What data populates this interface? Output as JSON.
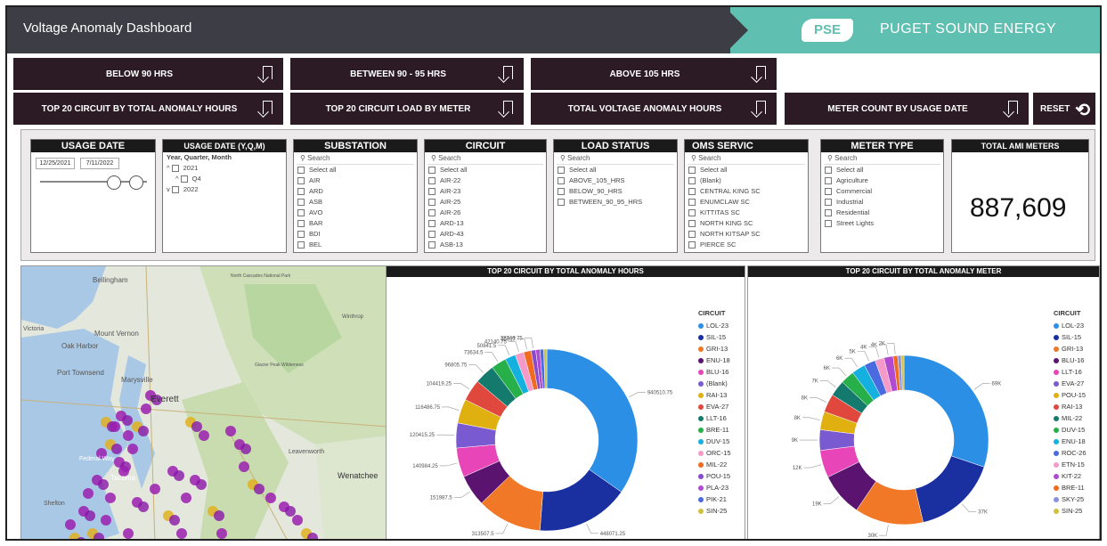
{
  "header": {
    "title": "Voltage Anomaly Dashboard",
    "logo_text": "PSE",
    "company": "PUGET SOUND ENERGY"
  },
  "buttons": {
    "below_90": "BELOW 90 HRS",
    "between_90_95": "BETWEEN 90 - 95 HRS",
    "above_105": "ABOVE 105 HRS",
    "top20_anomaly": "TOP 20 CIRCUIT BY TOTAL ANOMALY HOURS",
    "top20_load": "TOP 20 CIRCUIT LOAD BY METER",
    "total_voltage": "TOTAL VOLTAGE ANOMALY HOURS",
    "meter_count": "METER COUNT BY USAGE DATE",
    "reset": "RESET"
  },
  "slicers": {
    "usage_date": {
      "title": "USAGE DATE",
      "start": "12/25/2021",
      "end": "7/11/2022"
    },
    "usage_date_yqm": {
      "title": "USAGE DATE (Y,Q,M)",
      "subtitle": "Year, Quarter, Month",
      "items": [
        "2021",
        "Q4",
        "2022"
      ]
    },
    "substation": {
      "title": "SUBSTATION",
      "search": "Search",
      "items": [
        "Select all",
        "AIR",
        "ARD",
        "ASB",
        "AVO",
        "BAR",
        "BDI",
        "BEL"
      ]
    },
    "circuit": {
      "title": "CIRCUIT",
      "search": "Search",
      "items": [
        "Select all",
        "AIR-22",
        "AIR-23",
        "AIR-25",
        "AIR-26",
        "ARD-13",
        "ARD-43",
        "ASB-13"
      ]
    },
    "load_status": {
      "title": "LOAD STATUS",
      "search": "Search",
      "items": [
        "Select all",
        "ABOVE_105_HRS",
        "BELOW_90_HRS",
        "BETWEEN_90_95_HRS"
      ]
    },
    "oms_service": {
      "title": "OMS SERVIC",
      "search": "Search",
      "items": [
        "Select all",
        "(Blank)",
        "CENTRAL KING SC",
        "ENUMCLAW SC",
        "KITTITAS SC",
        "NORTH KING SC",
        "NORTH KITSAP SC",
        "PIERCE SC"
      ]
    },
    "meter_type": {
      "title": "METER TYPE",
      "search": "Search",
      "items": [
        "Select all",
        "Agriculture",
        "Commercial",
        "Industrial",
        "Residential",
        "Street Lights"
      ]
    },
    "total_ami": {
      "title": "TOTAL AMI METERS",
      "value": "887,609"
    }
  },
  "map": {
    "labels": [
      "Bellingham",
      "Mount Vernon",
      "Oak Harbor",
      "Port Townsend",
      "Marysville",
      "Everett",
      "Leavenworth",
      "Wenatchee",
      "Victoria",
      "Federal Way",
      "Tacoma",
      "Shelton",
      "Winthrop",
      "North Cascades National Park",
      "Glacier Peak Wilderness"
    ]
  },
  "chart_left": {
    "title": "TOP 20 CIRCUIT BY TOTAL ANOMALY HOURS",
    "legend_title": "CIRCUIT",
    "legend": [
      "LOL-23",
      "SIL-15",
      "GRI-13",
      "ENU-18",
      "BLU-16",
      "(Blank)",
      "RAI-13",
      "EVA-27",
      "LLT-16",
      "BRE-11",
      "DUV-15",
      "ORC-15",
      "MIL-22",
      "POU-15",
      "PLA-23",
      "PIK-21",
      "SIN-25"
    ],
    "labels": [
      "940510.75",
      "448071.25",
      "313507.5",
      "151987.5",
      "140984.25",
      "120415.25",
      "116486.75",
      "104419.25",
      "96805.75",
      "73634.5",
      "50841.5",
      "42140.75",
      "35817",
      "22746.75"
    ]
  },
  "chart_right": {
    "title": "TOP 20 CIRCUIT BY TOTAL ANOMALY METER",
    "legend_title": "CIRCUIT",
    "legend": [
      "LOL-23",
      "SIL-15",
      "GRI-13",
      "BLU-16",
      "LLT-16",
      "EVA-27",
      "POU-15",
      "RAI-13",
      "MIL-22",
      "DUV-15",
      "ENU-18",
      "ROC-26",
      "ETN-15",
      "KIT-22",
      "BRE-11",
      "SKY-25",
      "SIN-25"
    ],
    "labels": [
      "69K",
      "37K",
      "30K",
      "19K",
      "12K",
      "9K",
      "8K",
      "8K",
      "7K",
      "6K",
      "6K",
      "5K",
      "4K",
      "4K",
      "2K"
    ]
  },
  "chart_data": [
    {
      "type": "pie",
      "title": "TOP 20 CIRCUIT BY TOTAL ANOMALY HOURS",
      "categories": [
        "LOL-23",
        "SIL-15",
        "GRI-13",
        "ENU-18",
        "BLU-16",
        "(Blank)",
        "RAI-13",
        "EVA-27",
        "LLT-16",
        "BRE-11",
        "DUV-15",
        "ORC-15",
        "MIL-22",
        "POU-15",
        "PLA-23",
        "PIK-21",
        "SIN-25"
      ],
      "values": [
        940510.75,
        448071.25,
        313507.5,
        151987.5,
        140984.25,
        120415.25,
        116486.75,
        104419.25,
        96805.75,
        73634.5,
        50841.5,
        42140.75,
        35817,
        22746.75,
        20000,
        18000,
        15000
      ],
      "colors": [
        "#2b8fe6",
        "#1a2fa0",
        "#f07826",
        "#5a1470",
        "#e846b8",
        "#7a5ad0",
        "#e0b010",
        "#e0483e",
        "#157a6e",
        "#27b04a",
        "#13b0e0",
        "#f59ac8",
        "#f06a20",
        "#8a4ad0",
        "#b04ad0",
        "#4a6ae0",
        "#d0c040"
      ]
    },
    {
      "type": "pie",
      "title": "TOP 20 CIRCUIT BY TOTAL ANOMALY METER",
      "categories": [
        "LOL-23",
        "SIL-15",
        "GRI-13",
        "BLU-16",
        "LLT-16",
        "EVA-27",
        "POU-15",
        "RAI-13",
        "MIL-22",
        "DUV-15",
        "ENU-18",
        "ROC-26",
        "ETN-15",
        "KIT-22",
        "BRE-11",
        "SKY-25",
        "SIN-25"
      ],
      "values": [
        69000,
        37000,
        30000,
        19000,
        12000,
        9000,
        8000,
        8000,
        7000,
        6000,
        6000,
        5000,
        4000,
        4000,
        2000,
        1500,
        1200
      ],
      "colors": [
        "#2b8fe6",
        "#1a2fa0",
        "#f07826",
        "#5a1470",
        "#e846b8",
        "#7a5ad0",
        "#e0b010",
        "#e0483e",
        "#157a6e",
        "#27b04a",
        "#13b0e0",
        "#4a6ae0",
        "#f59ac8",
        "#b04ad0",
        "#f06a20",
        "#8a90e0",
        "#d0c040"
      ]
    }
  ]
}
